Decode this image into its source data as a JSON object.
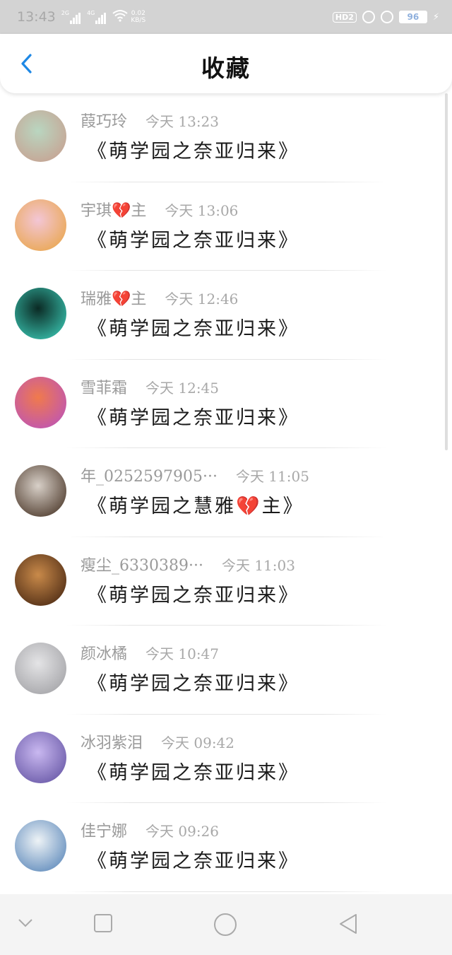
{
  "status_bar": {
    "time": "13:43",
    "signal1_label": "2G",
    "signal2_label": "4G",
    "speed_value": "0.02",
    "speed_unit": "KB/S",
    "hd_label": "HD2",
    "battery": "96"
  },
  "header": {
    "title": "收藏",
    "back_icon": "chevron-left-icon"
  },
  "items": [
    {
      "name": "葭巧玲",
      "time": "今天 13:23",
      "message": "《萌学园之奈亚归来》",
      "avatar_colors": [
        "#b9d6c0",
        "#c99a8b"
      ]
    },
    {
      "name": "宇琪💔主",
      "time": "今天 13:06",
      "message": "《萌学园之奈亚归来》",
      "avatar_colors": [
        "#f3c6d6",
        "#e8a23a"
      ]
    },
    {
      "name": "瑞雅💔主",
      "time": "今天 12:46",
      "message": "《萌学园之奈亚归来》",
      "avatar_colors": [
        "#0b2a24",
        "#3fd7c2"
      ]
    },
    {
      "name": "雪菲霜",
      "time": "今天 12:45",
      "message": "《萌学园之奈亚归来》",
      "avatar_colors": [
        "#f07a4c",
        "#b64fc7"
      ]
    },
    {
      "name": "年_0252597905···",
      "time": "今天 11:05",
      "message": "《萌学园之慧雅💔主》",
      "avatar_colors": [
        "#d8d0c8",
        "#3a2516"
      ]
    },
    {
      "name": "瘦尘_6330389···",
      "time": "今天 11:03",
      "message": "《萌学园之奈亚归来》",
      "avatar_colors": [
        "#c98a4a",
        "#3b1d0c"
      ]
    },
    {
      "name": "颜冰橘",
      "time": "今天 10:47",
      "message": "《萌学园之奈亚归来》",
      "avatar_colors": [
        "#e4e4e6",
        "#9a9a9e"
      ]
    },
    {
      "name": "冰羽紫泪",
      "time": "今天 09:42",
      "message": "《萌学园之奈亚归来》",
      "avatar_colors": [
        "#c9b8f0",
        "#5a4a9c"
      ]
    },
    {
      "name": "佳宁娜",
      "time": "今天 09:26",
      "message": "《萌学园之奈亚归来》",
      "avatar_colors": [
        "#eef3f6",
        "#4a7bb3"
      ]
    }
  ],
  "nav_bar": {
    "icons": [
      "chevron-down-icon",
      "recent-apps-icon",
      "home-icon",
      "back-icon"
    ]
  },
  "colors": {
    "accent": "#1e88e5",
    "status_bar_bg": "#d3d3d3",
    "name_text": "#9a9a9a",
    "message_text": "#1a1a1a"
  }
}
